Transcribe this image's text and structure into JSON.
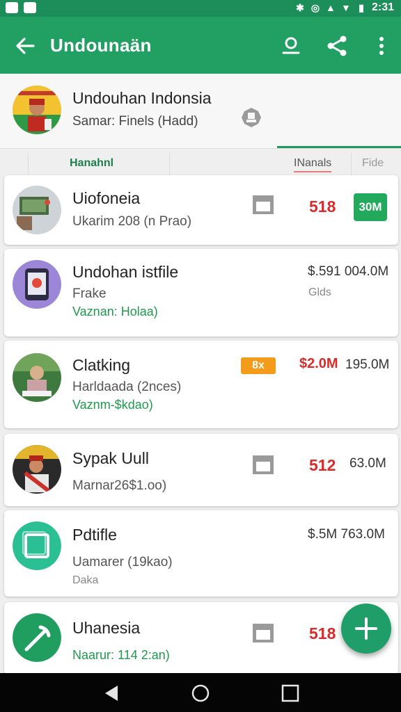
{
  "status_bar": {
    "time": "2:31"
  },
  "app_bar": {
    "title": "Undounaän"
  },
  "profile": {
    "name": "Undouhan Indonsia",
    "subtitle": "Samar: Finels (Hadd)"
  },
  "tabs": [
    {
      "label": "Hanahnl",
      "active": true
    },
    {
      "label": "INanals",
      "active": false
    },
    {
      "label": "Fide",
      "active": false
    }
  ],
  "items": [
    {
      "title": "Uiofoneia",
      "line2": "Ukarim 208 (n Prao)",
      "line3": "",
      "price_red": "518",
      "badge": "30M",
      "price": "",
      "sub": ""
    },
    {
      "title": "Undohan istfile",
      "line2": "Frake",
      "line3": "Vaznan: Holaa)",
      "price_red": "",
      "badge": "",
      "price": "$.591 004.0M",
      "sub": "Glds"
    },
    {
      "title": "Clatking",
      "line2": "Harldaada (2nces)",
      "line3": "Vaznm-$kdao)",
      "price_red": "$2.0M",
      "badge": "8x",
      "price": "195.0M",
      "sub": ""
    },
    {
      "title": "Sypak Uull",
      "line2": "Marnar26$1.oo)",
      "line3": "",
      "price_red": "512",
      "badge": "",
      "price": "63.0M",
      "sub": ""
    },
    {
      "title": "Pdtifle",
      "line2": "Uamarer (19kao)",
      "line3": "Daka",
      "price_red": "",
      "badge": "",
      "price": "$.5M 763.0M",
      "sub": ""
    },
    {
      "title": "Uhanesia",
      "line2": "Naarur: 114 2:an)",
      "line3": "",
      "price_red": "518",
      "badge": "",
      "price": "",
      "sub": ""
    }
  ],
  "colors": {
    "primary": "#22a063",
    "status": "#1b8e5a",
    "price_red": "#d92b2b",
    "badge_green": "#23a95c",
    "badge_orange": "#f39b1a",
    "text_green": "#1f9a4c"
  },
  "icons": [
    "back-arrow-icon",
    "person-icon",
    "share-icon",
    "more-vert-icon",
    "calendar-icon",
    "add-icon"
  ]
}
